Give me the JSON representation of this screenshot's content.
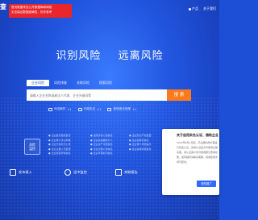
{
  "logo": {
    "text": "查"
  },
  "banner": {
    "line1": "首页数据来自公开数据库和网络",
    "line2": "无法保证数据准确性，仅作参考"
  },
  "nav": {
    "items": [
      "产品",
      "关于我们"
    ]
  },
  "slogan": {
    "left": "识别风险",
    "right": "远离风险"
  },
  "tabs": [
    "企业风险",
    "风险排查",
    "关联风险",
    "搜索风险"
  ],
  "search": {
    "placeholder": "请输入企业名称或者法人代表、企业关键词等",
    "button": "搜 索"
  },
  "stats": [
    {
      "label": "司法案件",
      "value": "+1"
    },
    {
      "label": "行政执法",
      "value": "+1"
    },
    {
      "label": "其他违法违规",
      "value": "+1"
    }
  ],
  "card": {
    "line1": "风险",
    "line2": "监控"
  },
  "lists": [
    [
      "● 企业股东股权变化",
      "● 企业重大诉讼仲裁",
      "● 企业行政处罚公告",
      "● 企业主要人员变更",
      "● 企业经营异常信息"
    ],
    [
      "● 法院涉诉公告信息",
      "● 企业失信被执行人",
      "● 企业资产冻结信息",
      "● 企业欠税公告信息",
      "● 企业环保处罚信息"
    ],
    [
      "● 企业知识产权变更",
      "● 企业招投标信息",
      "● 企业重大风险提示",
      "● 企业信用评级变化"
    ]
  ],
  "bottom": [
    {
      "label": "发布接入"
    },
    {
      "label": "设中监控"
    },
    {
      "label": "关联报告"
    }
  ],
  "popup": {
    "title": "关于启用实名认证、借助企业",
    "body": "2022年8月1日起，已注册的用户需进行实名认证，完成认证后方可使用全部功能，未认证用户仅可使用部分查询功能，如有疑问请联系客服，感谢您的支持与配合。",
    "button": "我知道了"
  }
}
